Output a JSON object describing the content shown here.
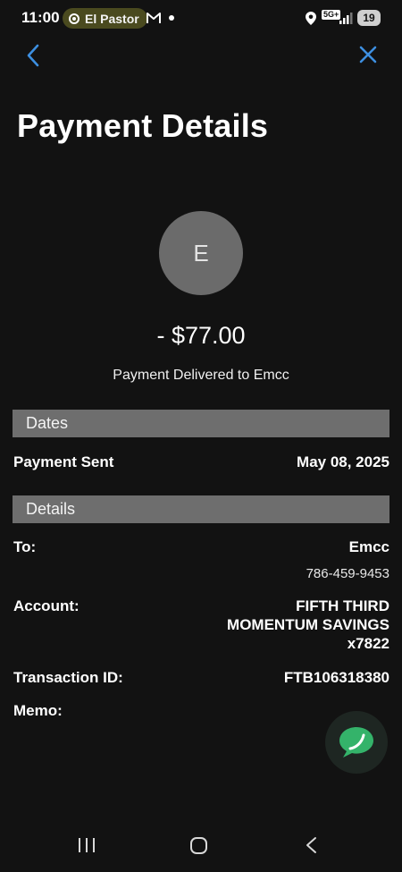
{
  "status_bar": {
    "time": "11:00",
    "notification_pill": "El Pastor",
    "network": "5G+",
    "battery": "19"
  },
  "header": {
    "title": "Payment Details",
    "back_icon": "chevron-left-icon",
    "close_icon": "close-icon",
    "accent_color": "#3d8fe0"
  },
  "payment": {
    "avatar_initial": "E",
    "amount": "- $77.00",
    "status": "Payment Delivered to Emcc"
  },
  "dates_section": {
    "title": "Dates",
    "payment_sent_label": "Payment Sent",
    "payment_sent_value": "May 08, 2025"
  },
  "details_section": {
    "title": "Details",
    "to_label": "To:",
    "to_name": "Emcc",
    "to_phone": "786-459-9453",
    "account_label": "Account:",
    "account_line1": "FIFTH THIRD",
    "account_line2": "MOMENTUM SAVINGS",
    "account_line3": "x7822",
    "transaction_label": "Transaction ID:",
    "transaction_value": "FTB106318380",
    "memo_label": "Memo:"
  },
  "chat_button": {
    "icon": "chat-bubble-icon",
    "color": "#34b36a"
  },
  "system_nav": {
    "recent_icon": "recent-apps-icon",
    "home_icon": "home-icon",
    "back_icon": "back-icon"
  }
}
